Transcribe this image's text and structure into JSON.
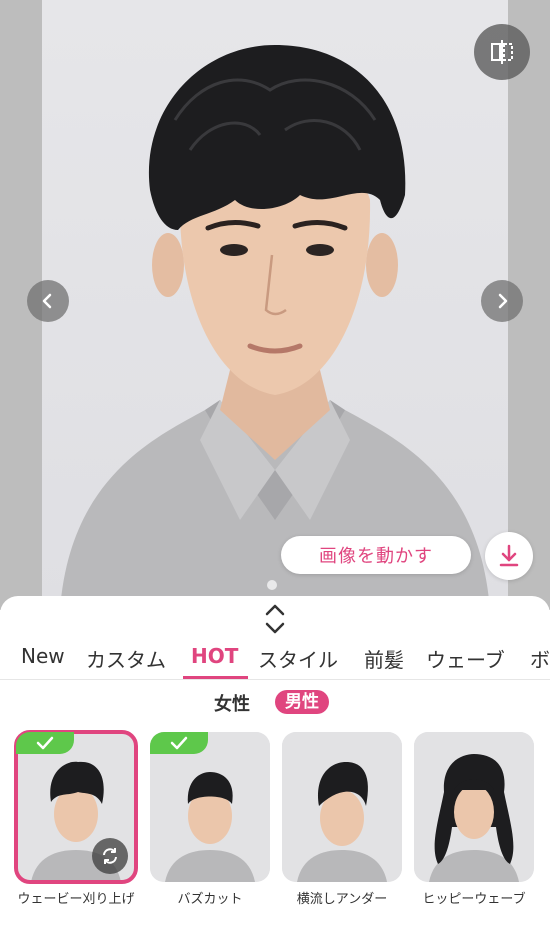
{
  "preview": {
    "move_image_label": "画像を動かす",
    "icons": {
      "compare": "split-compare-icon",
      "prev": "chevron-left-icon",
      "next": "chevron-right-icon",
      "download": "download-icon"
    }
  },
  "sheet": {
    "tabs": [
      {
        "label": "New"
      },
      {
        "label": "カスタム"
      },
      {
        "label": "HOT"
      },
      {
        "label": "スタイル"
      },
      {
        "label": "前髪"
      },
      {
        "label": "ウェーブ"
      },
      {
        "label": "ボ"
      }
    ],
    "active_tab": "HOT",
    "gender": {
      "female": "女性",
      "male": "男性",
      "selected": "男性"
    },
    "styles": [
      {
        "label": "ウェービー刈り上げ",
        "selected": true,
        "applied": true
      },
      {
        "label": "バズカット",
        "selected": false,
        "applied": true
      },
      {
        "label": "横流しアンダー",
        "selected": false,
        "applied": false
      },
      {
        "label": "ヒッピーウェーブ",
        "selected": false,
        "applied": false
      }
    ]
  },
  "colors": {
    "accent": "#e0457f",
    "check": "#5ec84b"
  }
}
